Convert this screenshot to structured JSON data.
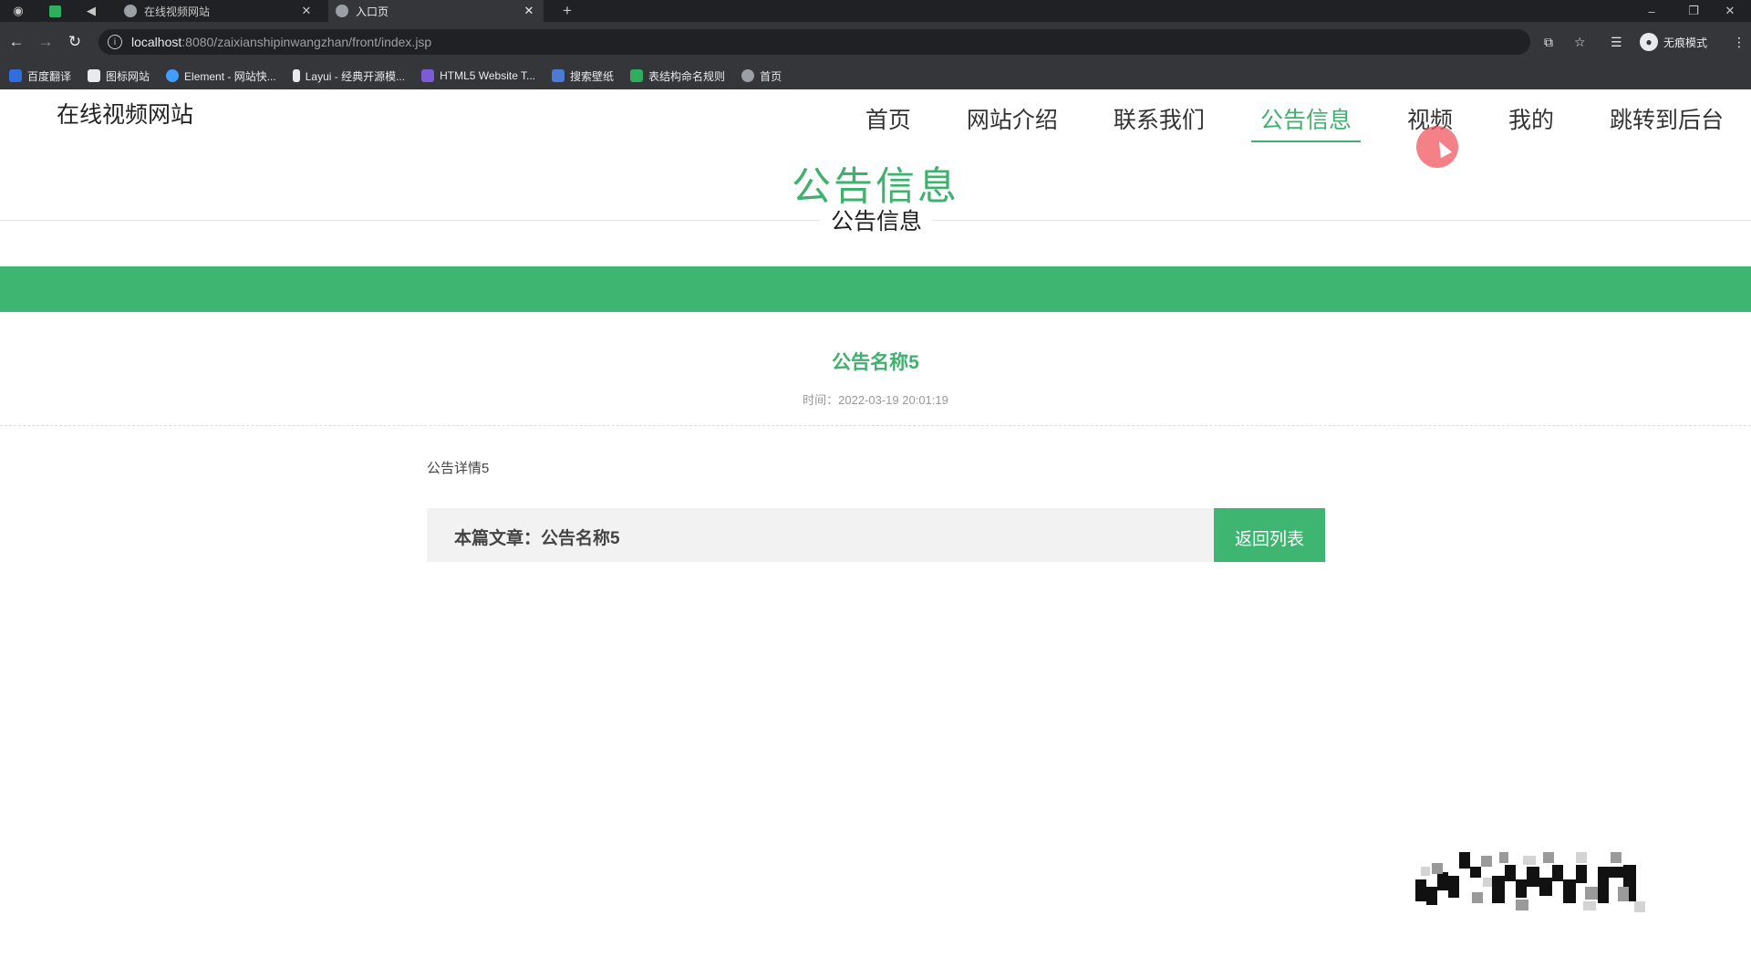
{
  "browser": {
    "tabs": [
      {
        "label": "在线视频网站",
        "active": false
      },
      {
        "label": "入口页",
        "active": true
      }
    ],
    "new_tab": "+",
    "url_host": "localhost",
    "url_path": ":8080/zaixianshipinwangzhan/front/index.jsp",
    "profile_label": "无痕模式",
    "bookmarks": [
      {
        "label": "百度翻译",
        "color": "#2f6ee0"
      },
      {
        "label": "图标网站",
        "color": "#e8eaed"
      },
      {
        "label": "Element - 网站快...",
        "color": "#409eff"
      },
      {
        "label": "Layui - 经典开源模...",
        "color": "#e8eaed"
      },
      {
        "label": "HTML5 Website T...",
        "color": "#7b5cd6"
      },
      {
        "label": "搜索壁纸",
        "color": "#4a7bd6"
      },
      {
        "label": "表结构命名规则",
        "color": "#2fae5e"
      },
      {
        "label": "首页",
        "color": "#9aa0a6"
      }
    ]
  },
  "site": {
    "title": "在线视频网站",
    "nav": [
      {
        "label": "首页",
        "active": false
      },
      {
        "label": "网站介绍",
        "active": false
      },
      {
        "label": "联系我们",
        "active": false
      },
      {
        "label": "公告信息",
        "active": true
      },
      {
        "label": "视频",
        "active": false
      },
      {
        "label": "我的",
        "active": false
      },
      {
        "label": "跳转到后台",
        "active": false
      }
    ]
  },
  "hero": {
    "title": "公告信息",
    "subtitle": "公告信息"
  },
  "article": {
    "title": "公告名称5",
    "time": "时间：2022-03-19 20:01:19",
    "body": "公告详情5",
    "footer_label": "本篇文章：公告名称5",
    "back_label": "返回列表"
  },
  "colors": {
    "accent": "#3fb06e",
    "band": "#3fb572"
  }
}
